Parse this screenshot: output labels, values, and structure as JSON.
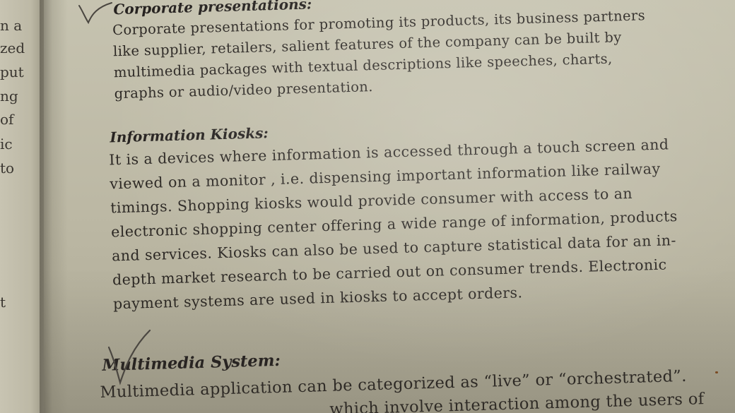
{
  "left_margin_fragments": [
    "n a",
    "zed",
    "put",
    "ng",
    "of",
    "ic",
    "to",
    "t"
  ],
  "sections": [
    {
      "heading": "Corporate presentations:",
      "lines": [
        "Corporate presentations for promoting its products, its business partners",
        "like supplier, retailers, salient features of the company can be built by",
        "multimedia packages with textual descriptions like speeches, charts,",
        "graphs or audio/video presentation."
      ]
    },
    {
      "heading": "Information Kiosks:",
      "lines": [
        "It is a devices where information is accessed through a touch screen and",
        "viewed on a monitor , i.e. dispensing important information like railway",
        "timings.  Shopping kiosks would provide consumer with access to an",
        "electronic shopping center offering a wide range of information, products",
        "and services. Kiosks can also be used to capture statistical data for an in-",
        "depth market research to be carried out on consumer trends. Electronic",
        "payment systems are used in kiosks to accept orders."
      ]
    },
    {
      "heading": "Multimedia System:",
      "lines": [
        "Multimedia application can be categorized as “live” or “orchestrated”.",
        "which involve interaction among the users of"
      ]
    }
  ]
}
